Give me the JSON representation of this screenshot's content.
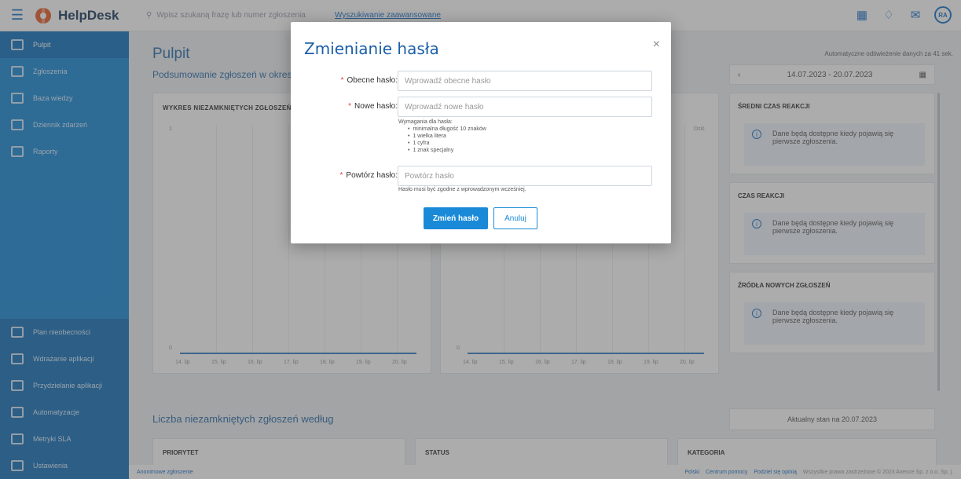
{
  "app": {
    "name": "HelpDesk",
    "avatar_initials": "RA"
  },
  "search": {
    "placeholder": "Wpisz szukaną frazę lub numer zgłoszenia",
    "advanced_link": "Wyszukiwanie zaawansowane"
  },
  "sidebar": {
    "items": [
      {
        "label": "Pulpit",
        "icon": "dashboard-icon"
      },
      {
        "label": "Zgłoszenia",
        "icon": "tickets-icon"
      },
      {
        "label": "Baza wiedzy",
        "icon": "knowledge-base-icon"
      },
      {
        "label": "Dziennik zdarzeń",
        "icon": "event-log-icon"
      },
      {
        "label": "Raporty",
        "icon": "reports-icon"
      }
    ],
    "bottom_items": [
      {
        "label": "Plan nieobecności",
        "icon": "absence-plan-icon"
      },
      {
        "label": "Wdrażanie aplikacji",
        "icon": "deploy-icon"
      },
      {
        "label": "Przydzielanie aplikacji",
        "icon": "assign-icon"
      },
      {
        "label": "Automatyzacje",
        "icon": "automation-icon"
      },
      {
        "label": "Metryki SLA",
        "icon": "sla-icon"
      },
      {
        "label": "Ustawienia",
        "icon": "settings-icon"
      }
    ]
  },
  "main": {
    "title": "Pulpit",
    "subtitle": "Podsumowanie zgłoszeń w okresie",
    "chart_title": "WYKRES NIEZAMKNIĘTYCH ZGŁOSZEŃ",
    "chart2_legend": "Dziś",
    "x_labels": [
      "14. lip",
      "15. lip",
      "16. lip",
      "17. lip",
      "18. lip",
      "19. lip",
      "20. lip"
    ],
    "y_top": "1",
    "y_bottom": "0",
    "auto_refresh": "Automatyczne odświeżenie danych za 41 sek.",
    "date_range": "14.07.2023 - 20.07.2023",
    "cards": [
      {
        "title": "ŚREDNI CZAS REAKCJI",
        "body": "Dane będą dostępne kiedy pojawią się pierwsze zgłoszenia."
      },
      {
        "title": "CZAS REAKCJI",
        "body": "Dane będą dostępne kiedy pojawią się pierwsze zgłoszenia."
      },
      {
        "title": "ŹRÓDŁA NOWYCH ZGŁOSZEŃ",
        "body": "Dane będą dostępne kiedy pojawią się pierwsze zgłoszenia."
      }
    ],
    "bottom_title": "Liczba niezamkniętych zgłoszeń według",
    "bottom_state": "Aktualny stan na 20.07.2023",
    "bottom_cols": [
      "PRIORYTET",
      "STATUS",
      "KATEGORIA"
    ]
  },
  "footer": {
    "left_link": "Anonimowe zgłoszenie",
    "language": "Polski",
    "help": "Centrum pomocy",
    "opinion": "Podziel się opinią",
    "copyright": "Wszystkie prawa zastrzeżone © 2023 Axence Sp. z o.o. Sp. j."
  },
  "modal": {
    "title": "Zmienianie hasła",
    "close_label": "×",
    "current_label": "Obecne hasło:",
    "current_placeholder": "Wprowadź obecne hasło",
    "new_label": "Nowe hasło:",
    "new_placeholder": "Wprowadź nowe hasło",
    "requirements_title": "Wymagania dla hasła:",
    "requirements": [
      "minimalna długość 10 znaków",
      "1 wielka litera",
      "1 cyfra",
      "1 znak specjalny"
    ],
    "repeat_label": "Powtórz hasło:",
    "repeat_placeholder": "Powtórz hasło",
    "repeat_hint": "Hasło musi być zgodne z wprowadzonym wcześniej.",
    "submit": "Zmień hasło",
    "cancel": "Anuluj"
  }
}
